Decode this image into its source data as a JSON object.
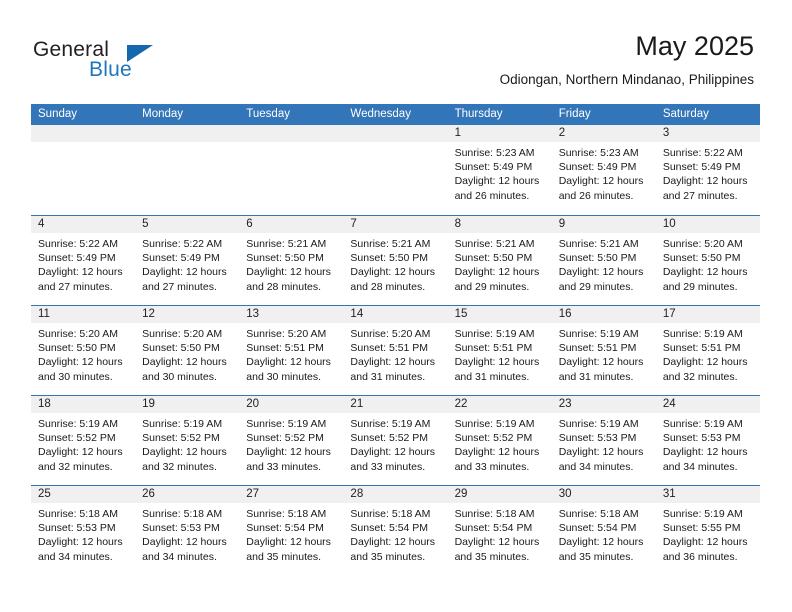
{
  "brand": {
    "name_part1": "General",
    "name_part2": "Blue",
    "triangle_color": "#1567ae",
    "blue_color": "#1d76bd"
  },
  "header": {
    "title": "May 2025",
    "subtitle": "Odiongan, Northern Mindanao, Philippines"
  },
  "theme": {
    "header_blue": "#3275b8",
    "day_band_gray": "#f0f0f0"
  },
  "weekdays": [
    "Sunday",
    "Monday",
    "Tuesday",
    "Wednesday",
    "Thursday",
    "Friday",
    "Saturday"
  ],
  "weeks": [
    [
      {
        "day": "",
        "lines": []
      },
      {
        "day": "",
        "lines": []
      },
      {
        "day": "",
        "lines": []
      },
      {
        "day": "",
        "lines": []
      },
      {
        "day": "1",
        "lines": [
          "Sunrise: 5:23 AM",
          "Sunset: 5:49 PM",
          "Daylight: 12 hours",
          "and 26 minutes."
        ]
      },
      {
        "day": "2",
        "lines": [
          "Sunrise: 5:23 AM",
          "Sunset: 5:49 PM",
          "Daylight: 12 hours",
          "and 26 minutes."
        ]
      },
      {
        "day": "3",
        "lines": [
          "Sunrise: 5:22 AM",
          "Sunset: 5:49 PM",
          "Daylight: 12 hours",
          "and 27 minutes."
        ]
      }
    ],
    [
      {
        "day": "4",
        "lines": [
          "Sunrise: 5:22 AM",
          "Sunset: 5:49 PM",
          "Daylight: 12 hours",
          "and 27 minutes."
        ]
      },
      {
        "day": "5",
        "lines": [
          "Sunrise: 5:22 AM",
          "Sunset: 5:49 PM",
          "Daylight: 12 hours",
          "and 27 minutes."
        ]
      },
      {
        "day": "6",
        "lines": [
          "Sunrise: 5:21 AM",
          "Sunset: 5:50 PM",
          "Daylight: 12 hours",
          "and 28 minutes."
        ]
      },
      {
        "day": "7",
        "lines": [
          "Sunrise: 5:21 AM",
          "Sunset: 5:50 PM",
          "Daylight: 12 hours",
          "and 28 minutes."
        ]
      },
      {
        "day": "8",
        "lines": [
          "Sunrise: 5:21 AM",
          "Sunset: 5:50 PM",
          "Daylight: 12 hours",
          "and 29 minutes."
        ]
      },
      {
        "day": "9",
        "lines": [
          "Sunrise: 5:21 AM",
          "Sunset: 5:50 PM",
          "Daylight: 12 hours",
          "and 29 minutes."
        ]
      },
      {
        "day": "10",
        "lines": [
          "Sunrise: 5:20 AM",
          "Sunset: 5:50 PM",
          "Daylight: 12 hours",
          "and 29 minutes."
        ]
      }
    ],
    [
      {
        "day": "11",
        "lines": [
          "Sunrise: 5:20 AM",
          "Sunset: 5:50 PM",
          "Daylight: 12 hours",
          "and 30 minutes."
        ]
      },
      {
        "day": "12",
        "lines": [
          "Sunrise: 5:20 AM",
          "Sunset: 5:50 PM",
          "Daylight: 12 hours",
          "and 30 minutes."
        ]
      },
      {
        "day": "13",
        "lines": [
          "Sunrise: 5:20 AM",
          "Sunset: 5:51 PM",
          "Daylight: 12 hours",
          "and 30 minutes."
        ]
      },
      {
        "day": "14",
        "lines": [
          "Sunrise: 5:20 AM",
          "Sunset: 5:51 PM",
          "Daylight: 12 hours",
          "and 31 minutes."
        ]
      },
      {
        "day": "15",
        "lines": [
          "Sunrise: 5:19 AM",
          "Sunset: 5:51 PM",
          "Daylight: 12 hours",
          "and 31 minutes."
        ]
      },
      {
        "day": "16",
        "lines": [
          "Sunrise: 5:19 AM",
          "Sunset: 5:51 PM",
          "Daylight: 12 hours",
          "and 31 minutes."
        ]
      },
      {
        "day": "17",
        "lines": [
          "Sunrise: 5:19 AM",
          "Sunset: 5:51 PM",
          "Daylight: 12 hours",
          "and 32 minutes."
        ]
      }
    ],
    [
      {
        "day": "18",
        "lines": [
          "Sunrise: 5:19 AM",
          "Sunset: 5:52 PM",
          "Daylight: 12 hours",
          "and 32 minutes."
        ]
      },
      {
        "day": "19",
        "lines": [
          "Sunrise: 5:19 AM",
          "Sunset: 5:52 PM",
          "Daylight: 12 hours",
          "and 32 minutes."
        ]
      },
      {
        "day": "20",
        "lines": [
          "Sunrise: 5:19 AM",
          "Sunset: 5:52 PM",
          "Daylight: 12 hours",
          "and 33 minutes."
        ]
      },
      {
        "day": "21",
        "lines": [
          "Sunrise: 5:19 AM",
          "Sunset: 5:52 PM",
          "Daylight: 12 hours",
          "and 33 minutes."
        ]
      },
      {
        "day": "22",
        "lines": [
          "Sunrise: 5:19 AM",
          "Sunset: 5:52 PM",
          "Daylight: 12 hours",
          "and 33 minutes."
        ]
      },
      {
        "day": "23",
        "lines": [
          "Sunrise: 5:19 AM",
          "Sunset: 5:53 PM",
          "Daylight: 12 hours",
          "and 34 minutes."
        ]
      },
      {
        "day": "24",
        "lines": [
          "Sunrise: 5:19 AM",
          "Sunset: 5:53 PM",
          "Daylight: 12 hours",
          "and 34 minutes."
        ]
      }
    ],
    [
      {
        "day": "25",
        "lines": [
          "Sunrise: 5:18 AM",
          "Sunset: 5:53 PM",
          "Daylight: 12 hours",
          "and 34 minutes."
        ]
      },
      {
        "day": "26",
        "lines": [
          "Sunrise: 5:18 AM",
          "Sunset: 5:53 PM",
          "Daylight: 12 hours",
          "and 34 minutes."
        ]
      },
      {
        "day": "27",
        "lines": [
          "Sunrise: 5:18 AM",
          "Sunset: 5:54 PM",
          "Daylight: 12 hours",
          "and 35 minutes."
        ]
      },
      {
        "day": "28",
        "lines": [
          "Sunrise: 5:18 AM",
          "Sunset: 5:54 PM",
          "Daylight: 12 hours",
          "and 35 minutes."
        ]
      },
      {
        "day": "29",
        "lines": [
          "Sunrise: 5:18 AM",
          "Sunset: 5:54 PM",
          "Daylight: 12 hours",
          "and 35 minutes."
        ]
      },
      {
        "day": "30",
        "lines": [
          "Sunrise: 5:18 AM",
          "Sunset: 5:54 PM",
          "Daylight: 12 hours",
          "and 35 minutes."
        ]
      },
      {
        "day": "31",
        "lines": [
          "Sunrise: 5:19 AM",
          "Sunset: 5:55 PM",
          "Daylight: 12 hours",
          "and 36 minutes."
        ]
      }
    ]
  ]
}
